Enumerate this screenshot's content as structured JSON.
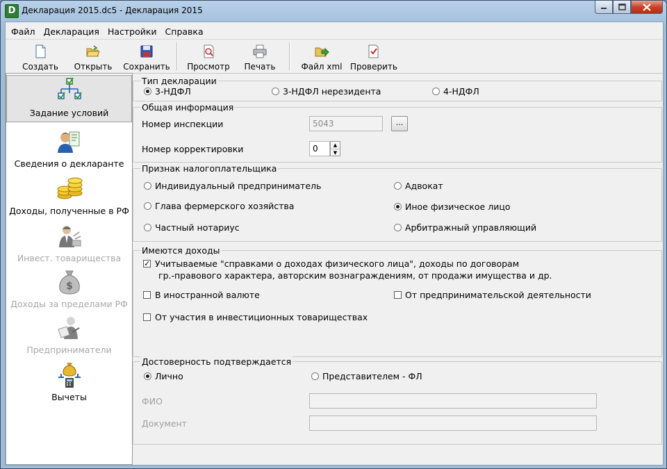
{
  "window": {
    "title": "Декларация 2015.dc5 - Декларация 2015",
    "app_icon_letter": "D"
  },
  "menu": [
    "Файл",
    "Декларация",
    "Настройки",
    "Справка"
  ],
  "toolbar": {
    "create": "Создать",
    "open": "Открыть",
    "save": "Сохранить",
    "preview": "Просмотр",
    "print": "Печать",
    "xml_file": "Файл xml",
    "check": "Проверить"
  },
  "sidebar": {
    "items": [
      {
        "label": "Задание условий",
        "icon": "conditions-icon",
        "selected": true,
        "enabled": true
      },
      {
        "label": "Сведения о декларанте",
        "icon": "declarant-icon",
        "enabled": true
      },
      {
        "label": "Доходы, полученные в РФ",
        "icon": "coins-icon",
        "enabled": true
      },
      {
        "label": "Инвест. товарищества",
        "icon": "investor-icon",
        "enabled": false
      },
      {
        "label": "Доходы за пределами РФ",
        "icon": "money-bag-icon",
        "enabled": false
      },
      {
        "label": "Предприниматели",
        "icon": "entrepreneur-icon",
        "enabled": false
      },
      {
        "label": "Вычеты",
        "icon": "deductions-icon",
        "enabled": true
      }
    ]
  },
  "decl_type": {
    "title": "Тип декларации",
    "options": [
      "3-НДФЛ",
      "3-НДФЛ нерезидента",
      "4-НДФЛ"
    ],
    "selected": 0
  },
  "general": {
    "title": "Общая информация",
    "inspection_label": "Номер инспекции",
    "inspection_value": "5043",
    "browse_label": "...",
    "correction_label": "Номер корректировки",
    "correction_value": "0"
  },
  "taxpayer": {
    "title": "Признак налогоплательщика",
    "options_left": [
      "Индивидуальный предприниматель",
      "Глава фермерского хозяйства",
      "Частный нотариус"
    ],
    "options_right": [
      "Адвокат",
      "Иное физическое лицо",
      "Арбитражный управляющий"
    ],
    "selected": "Иное физическое лицо"
  },
  "income": {
    "title": "Имеются доходы",
    "main_line1": "Учитываемые \"справками о доходах физического лица\", доходы по договорам",
    "main_line2": "гр.-правового характера, авторским вознаграждениям, от продажи имущества и др.",
    "main_checked": true,
    "foreign_currency": "В иностранной валюте",
    "business": "От предпринимательской деятельности",
    "investment": "От участия в инвестиционных товариществах"
  },
  "confirmation": {
    "title": "Достоверность подтверждается",
    "personal": "Лично",
    "representative": "Представителем - ФЛ",
    "fio_label": "ФИО",
    "document_label": "Документ"
  }
}
